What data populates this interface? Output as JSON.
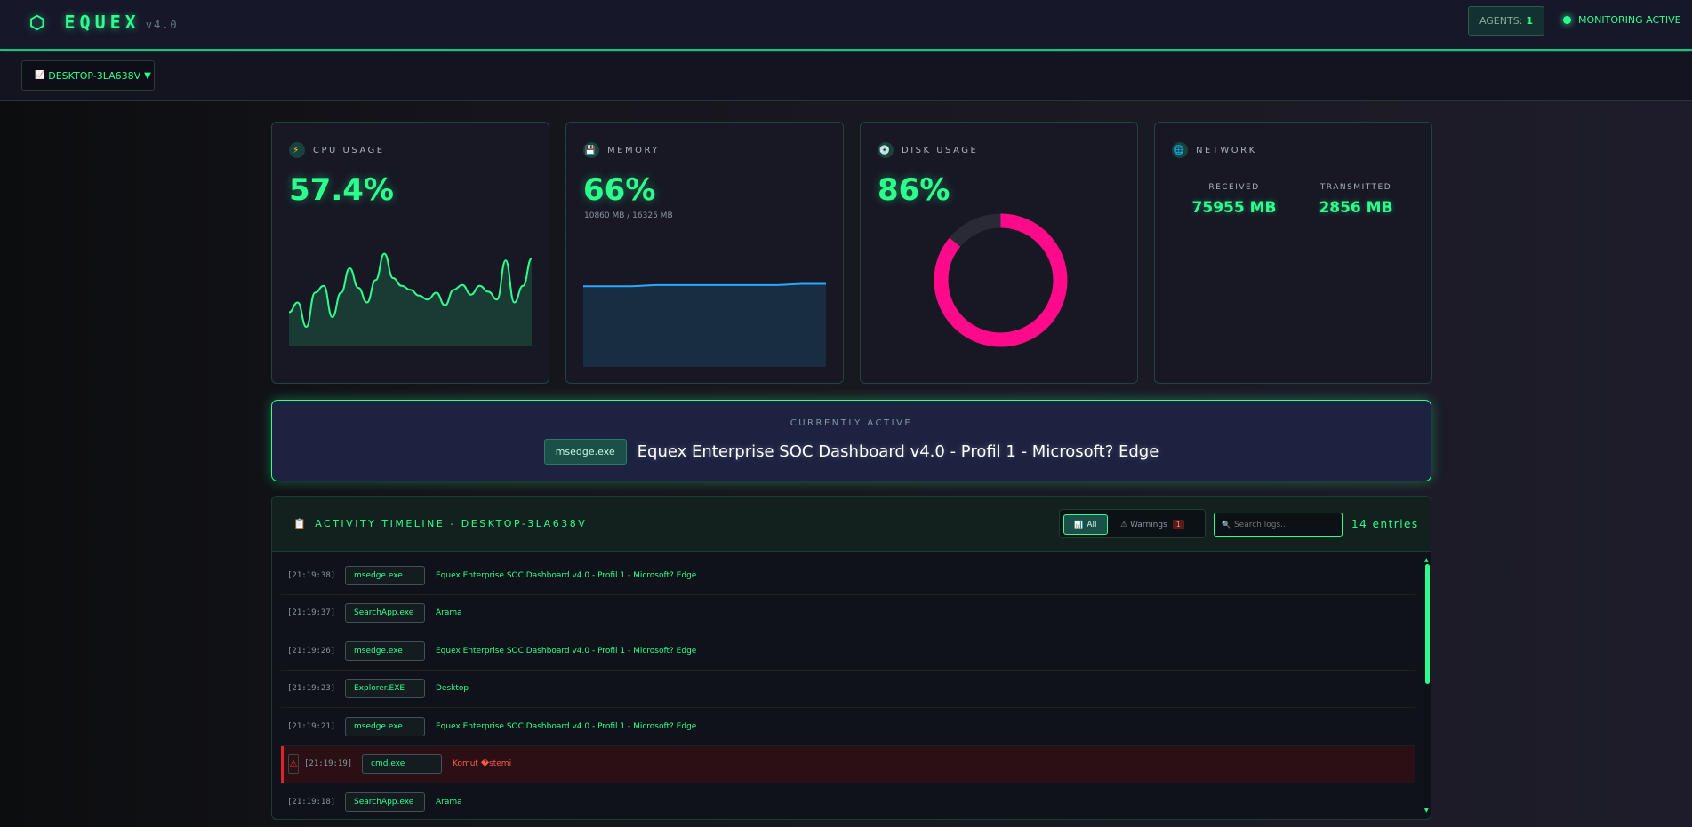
{
  "app": {
    "name": "EQUEX",
    "logo_glyph": "⬡",
    "version": "v4.0"
  },
  "header": {
    "agents_label": "AGENTS:",
    "agents_count": "1",
    "monitoring_label": "MONITORING ACTIVE"
  },
  "agent_selector": {
    "icon": "📈",
    "value": "DESKTOP-3LA638V",
    "caret": "▼"
  },
  "cpu": {
    "icon": "⚡",
    "label": "CPU USAGE",
    "value": "57.4%",
    "history": [
      0.35,
      0.45,
      0.2,
      0.55,
      0.62,
      0.3,
      0.55,
      0.8,
      0.6,
      0.45,
      0.68,
      0.95,
      0.7,
      0.62,
      0.58,
      0.52,
      0.48,
      0.55,
      0.42,
      0.58,
      0.63,
      0.53,
      0.62,
      0.56,
      0.48,
      0.88,
      0.45,
      0.62,
      0.9
    ]
  },
  "memory": {
    "icon": "💾",
    "label": "MEMORY",
    "value": "66%",
    "detail": "10860 MB / 16325 MB",
    "history": [
      0.66,
      0.66,
      0.66,
      0.67,
      0.67,
      0.67,
      0.67,
      0.67,
      0.67,
      0.68,
      0.68
    ]
  },
  "disk": {
    "icon": "💿",
    "label": "DISK USAGE",
    "value": "86%",
    "fraction": 0.86,
    "color": "#ff0a8a"
  },
  "network": {
    "icon": "🌐",
    "label": "NETWORK",
    "received_label": "RECEIVED",
    "received_value": "75955 MB",
    "transmitted_label": "TRANSMITTED",
    "transmitted_value": "2856 MB"
  },
  "active": {
    "label": "CURRENTLY ACTIVE",
    "process": "msedge.exe",
    "title": "Equex Enterprise SOC Dashboard v4.0 - Profil 1 - Microsoft? Edge"
  },
  "timeline": {
    "icon": "📋",
    "title": "ACTIVITY TIMELINE - DESKTOP-3LA638V",
    "filter_all_icon": "📊",
    "filter_all": "All",
    "filter_warnings_icon": "⚠",
    "filter_warnings": "Warnings",
    "warnings_count": "1",
    "search_icon": "🔍",
    "search_placeholder": "Search logs...",
    "entries": "14 entries",
    "logs": [
      {
        "time": "[21:19:38]",
        "process": "msedge.exe",
        "message": "Equex Enterprise SOC Dashboard v4.0 - Profil 1 - Microsoft? Edge",
        "warning": false
      },
      {
        "time": "[21:19:37]",
        "process": "SearchApp.exe",
        "message": "Arama",
        "warning": false
      },
      {
        "time": "[21:19:26]",
        "process": "msedge.exe",
        "message": "Equex Enterprise SOC Dashboard v4.0 - Profil 1 - Microsoft? Edge",
        "warning": false
      },
      {
        "time": "[21:19:23]",
        "process": "Explorer.EXE",
        "message": "Desktop",
        "warning": false
      },
      {
        "time": "[21:19:21]",
        "process": "msedge.exe",
        "message": "Equex Enterprise SOC Dashboard v4.0 - Profil 1 - Microsoft? Edge",
        "warning": false
      },
      {
        "time": "[21:19:19]",
        "process": "cmd.exe",
        "message": "Komut �stemi",
        "warning": true,
        "warning_icon": "⚠"
      },
      {
        "time": "[21:19:18]",
        "process": "SearchApp.exe",
        "message": "Arama",
        "warning": false
      }
    ]
  }
}
